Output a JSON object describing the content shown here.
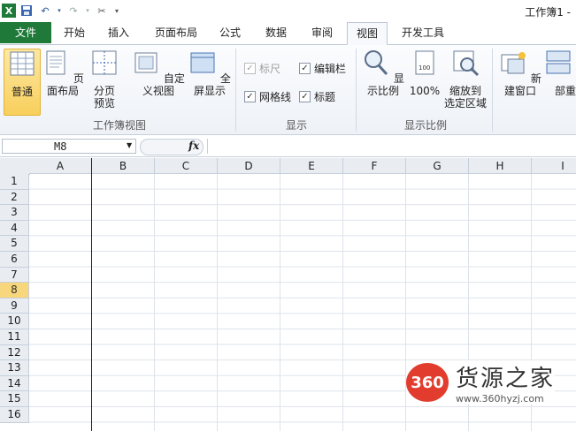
{
  "window": {
    "title": "工作簿1 -"
  },
  "tabs": [
    {
      "label": "文件",
      "kind": "file"
    },
    {
      "label": "开始"
    },
    {
      "label": "插入"
    },
    {
      "label": "页面布局"
    },
    {
      "label": "公式"
    },
    {
      "label": "数据"
    },
    {
      "label": "审阅"
    },
    {
      "label": "视图",
      "active": true
    },
    {
      "label": "开发工具"
    }
  ],
  "ribbon": {
    "workbook_views": {
      "label": "工作簿视图",
      "normal": "普通",
      "page_layout": "页面布局",
      "page_break_1": "分页",
      "page_break_2": "预览",
      "custom": "自定义视图",
      "full_screen": "全屏显示"
    },
    "show": {
      "label": "显示",
      "ruler": "标尺",
      "formula_bar": "编辑栏",
      "gridlines": "网格线",
      "headings": "标题"
    },
    "zoom": {
      "label": "显示比例",
      "zoom": "显示比例",
      "hundred": "100%",
      "sel_1": "缩放到",
      "sel_2": "选定区域"
    },
    "window": {
      "new_window": "新建窗口",
      "arrange_all": "全部重"
    }
  },
  "formula_bar": {
    "name_box": "M8",
    "fx": "fx"
  },
  "grid": {
    "columns": [
      "A",
      "B",
      "C",
      "D",
      "E",
      "F",
      "G",
      "H",
      "I"
    ],
    "rows": [
      "1",
      "2",
      "3",
      "4",
      "5",
      "6",
      "7",
      "8",
      "9",
      "10",
      "11",
      "12",
      "13",
      "14",
      "15",
      "16"
    ],
    "selected_row": "8"
  },
  "watermark": {
    "logo": "360",
    "name": "货源之家",
    "url": "www.360hyzj.com"
  },
  "colors": {
    "file_tab": "#1f7a3a",
    "selection": "#f8d77c"
  }
}
